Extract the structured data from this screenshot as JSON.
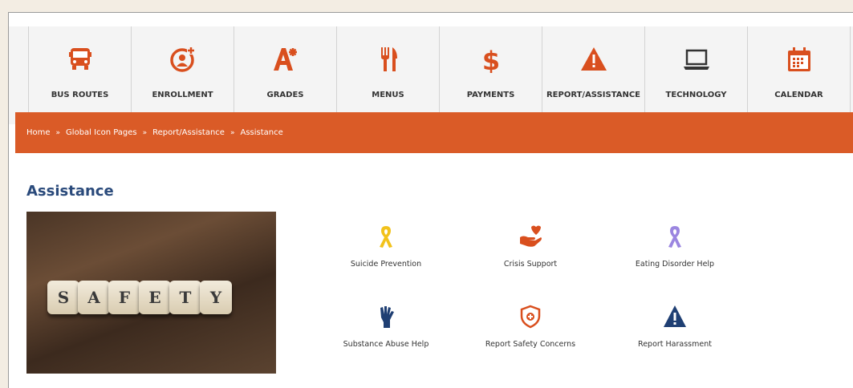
{
  "nav": {
    "items": [
      {
        "label": "BUS ROUTES",
        "icon": "bus-icon"
      },
      {
        "label": "ENROLLMENT",
        "icon": "add-user-icon"
      },
      {
        "label": "GRADES",
        "icon": "grades-icon"
      },
      {
        "label": "MENUS",
        "icon": "utensils-icon"
      },
      {
        "label": "PAYMENTS",
        "icon": "dollar-icon"
      },
      {
        "label": "REPORT/ASSISTANCE",
        "icon": "warning-icon"
      },
      {
        "label": "TECHNOLOGY",
        "icon": "laptop-icon"
      },
      {
        "label": "CALENDAR",
        "icon": "calendar-icon"
      }
    ],
    "icon_color": "#d94f1e"
  },
  "breadcrumb": {
    "items": [
      "Home",
      "Global Icon Pages",
      "Report/Assistance",
      "Assistance"
    ],
    "separator": "»",
    "bar_color": "#da5b27"
  },
  "page": {
    "title": "Assistance",
    "title_color": "#2a4a7b",
    "image_letters": [
      "S",
      "A",
      "F",
      "E",
      "T",
      "Y"
    ]
  },
  "links": [
    {
      "label": "Suicide Prevention",
      "icon": "yellow-ribbon-icon",
      "color": "#f2c21b"
    },
    {
      "label": "Crisis Support",
      "icon": "heart-hand-icon",
      "color": "#d94f1e"
    },
    {
      "label": "Eating Disorder Help",
      "icon": "purple-ribbon-icon",
      "color": "#9b86e0"
    },
    {
      "label": "Substance Abuse Help",
      "icon": "raised-hand-icon",
      "color": "#1f3f73"
    },
    {
      "label": "Report Safety Concerns",
      "icon": "shield-icon",
      "color": "#d94f1e"
    },
    {
      "label": "Report Harassment",
      "icon": "warning-icon",
      "color": "#1f3f73"
    }
  ]
}
